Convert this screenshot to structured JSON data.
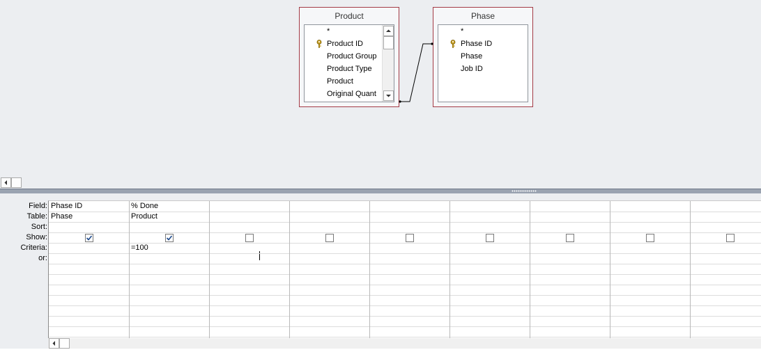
{
  "tables": [
    {
      "name": "Product",
      "fields": [
        {
          "label": "*",
          "key": false
        },
        {
          "label": "Product ID",
          "key": true
        },
        {
          "label": "Product Group",
          "key": false
        },
        {
          "label": "Product Type",
          "key": false
        },
        {
          "label": "Product",
          "key": false
        },
        {
          "label": "Original Quant",
          "key": false
        }
      ]
    },
    {
      "name": "Phase",
      "fields": [
        {
          "label": "*",
          "key": false
        },
        {
          "label": "Phase ID",
          "key": true
        },
        {
          "label": "Phase",
          "key": false
        },
        {
          "label": "Job ID",
          "key": false
        }
      ]
    }
  ],
  "grid": {
    "row_labels": [
      "Field:",
      "Table:",
      "Sort:",
      "Show:",
      "Criteria:",
      "or:"
    ],
    "columns": [
      {
        "field": "Phase ID",
        "table": "Phase",
        "sort": "",
        "show": true,
        "criteria": "",
        "or": ""
      },
      {
        "field": "% Done",
        "table": "Product",
        "sort": "",
        "show": true,
        "criteria": "=100",
        "or": ""
      },
      {
        "field": "",
        "table": "",
        "sort": "",
        "show": false,
        "criteria": "",
        "or": ""
      },
      {
        "field": "",
        "table": "",
        "sort": "",
        "show": false,
        "criteria": "",
        "or": ""
      },
      {
        "field": "",
        "table": "",
        "sort": "",
        "show": false,
        "criteria": "",
        "or": ""
      },
      {
        "field": "",
        "table": "",
        "sort": "",
        "show": false,
        "criteria": "",
        "or": ""
      },
      {
        "field": "",
        "table": "",
        "sort": "",
        "show": false,
        "criteria": "",
        "or": ""
      },
      {
        "field": "",
        "table": "",
        "sort": "",
        "show": false,
        "criteria": "",
        "or": ""
      },
      {
        "field": "",
        "table": "",
        "sort": "",
        "show": false,
        "criteria": "",
        "or": ""
      }
    ]
  },
  "colors": {
    "table_border": "#a33a45",
    "key_icon": "#c9a227",
    "relation_line": "#000000"
  },
  "icons": {
    "primary_key": "key-icon",
    "scroll_up": "arrow-up-icon",
    "scroll_down": "arrow-down-icon",
    "scroll_left": "arrow-left-icon"
  }
}
